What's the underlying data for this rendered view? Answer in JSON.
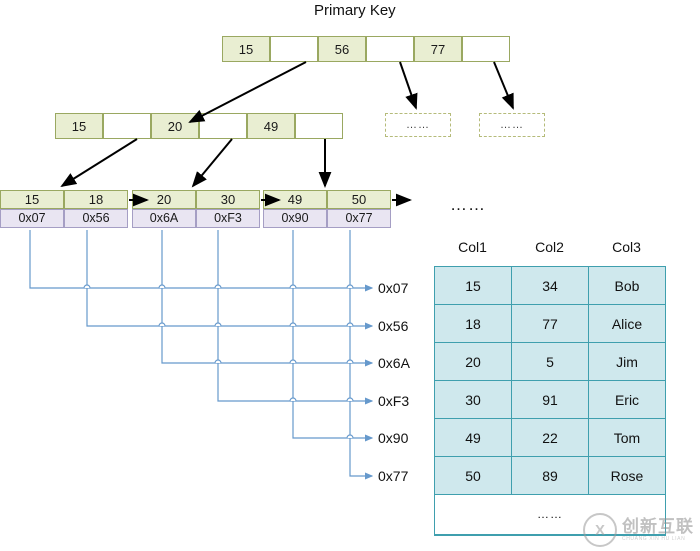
{
  "title": "Primary Key",
  "colors": {
    "node_fill": "#e9eed2",
    "node_border": "#9aa861",
    "pointer_fill": "#e9e5f2",
    "pointer_border": "#a59ec4",
    "table_fill": "#cfe8ed",
    "table_border": "#3f9fae",
    "wire": "#6699cc",
    "arrow": "#000000"
  },
  "root_node": {
    "name": "root-node",
    "cells": [
      {
        "label": "15",
        "empty": false
      },
      {
        "label": "",
        "empty": true
      },
      {
        "label": "56",
        "empty": false
      },
      {
        "label": "",
        "empty": true
      },
      {
        "label": "77",
        "empty": false
      },
      {
        "label": "",
        "empty": true
      }
    ]
  },
  "internal_node": {
    "name": "internal-node",
    "cells": [
      {
        "label": "15",
        "empty": false
      },
      {
        "label": "",
        "empty": true
      },
      {
        "label": "20",
        "empty": false
      },
      {
        "label": "",
        "empty": true
      },
      {
        "label": "49",
        "empty": false
      },
      {
        "label": "",
        "empty": true
      }
    ]
  },
  "leaf_nodes": [
    {
      "name": "leaf-node-1",
      "keys": [
        "15",
        "18"
      ],
      "pointers": [
        "0x07",
        "0x56"
      ]
    },
    {
      "name": "leaf-node-2",
      "keys": [
        "20",
        "30"
      ],
      "pointers": [
        "0x6A",
        "0xF3"
      ]
    },
    {
      "name": "leaf-node-3",
      "keys": [
        "49",
        "50"
      ],
      "pointers": [
        "0x90",
        "0x77"
      ]
    }
  ],
  "placeholder_boxes": [
    {
      "name": "placeholder-subtree-1",
      "label": "……"
    },
    {
      "name": "placeholder-subtree-2",
      "label": "……"
    }
  ],
  "pointer_labels": [
    {
      "name": "pointer-label-0x07",
      "label": "0x07"
    },
    {
      "name": "pointer-label-0x56",
      "label": "0x56"
    },
    {
      "name": "pointer-label-0x6A",
      "label": "0x6A"
    },
    {
      "name": "pointer-label-0xF3",
      "label": "0xF3"
    },
    {
      "name": "pointer-label-0x90",
      "label": "0x90"
    },
    {
      "name": "pointer-label-0x77",
      "label": "0x77"
    }
  ],
  "table_ellipsis": "……",
  "record_table": {
    "name": "record-table",
    "headers": [
      "Col1",
      "Col2",
      "Col3"
    ],
    "rows": [
      [
        "15",
        "34",
        "Bob"
      ],
      [
        "18",
        "77",
        "Alice"
      ],
      [
        "20",
        "5",
        "Jim"
      ],
      [
        "30",
        "91",
        "Eric"
      ],
      [
        "49",
        "22",
        "Tom"
      ],
      [
        "50",
        "89",
        "Rose"
      ]
    ],
    "more_label": "……"
  },
  "watermark": {
    "mark": "X",
    "chinese": "创新互联",
    "pinyin": "CHUANG XIN HU LIAN"
  }
}
